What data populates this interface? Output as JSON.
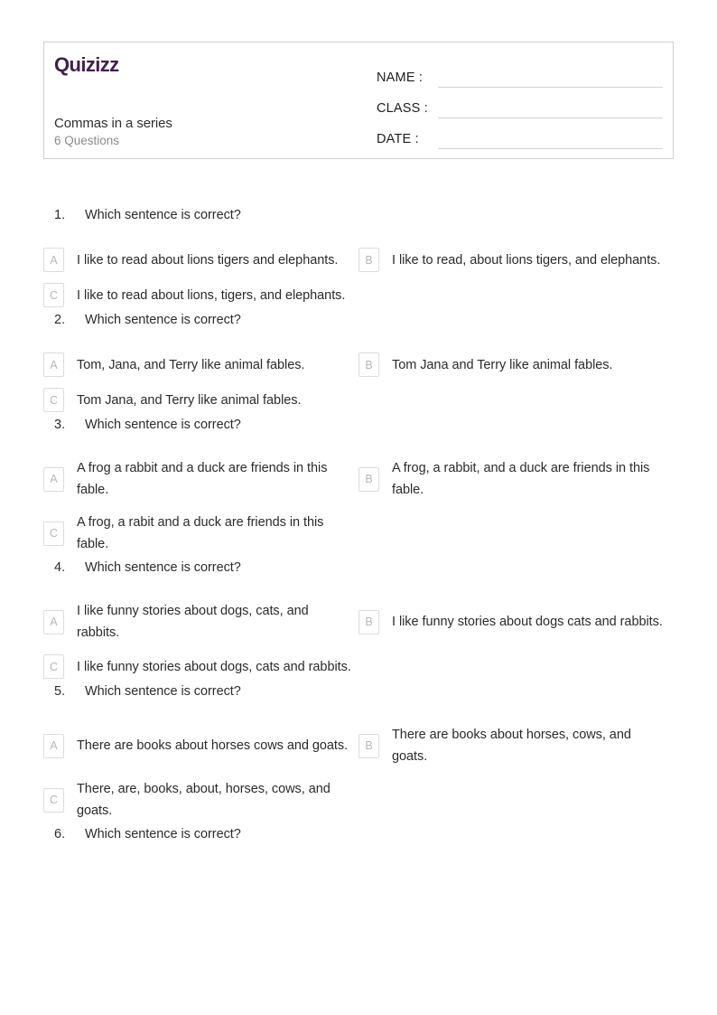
{
  "header": {
    "brand": "Quizizz",
    "worksheet_title": "Commas in a series",
    "question_count_label": "6 Questions",
    "fields": [
      {
        "label": "NAME :",
        "value": "",
        "name": "name-field"
      },
      {
        "label": "CLASS :",
        "value": "",
        "name": "class-field"
      },
      {
        "label": "DATE  :",
        "value": "",
        "name": "date-field"
      }
    ]
  },
  "colors": {
    "brand_purple": "#41204d",
    "text": "#2b2b2b",
    "muted": "#8b8b8b",
    "border": "#cfcfcf",
    "option_box_border": "#dcdcdc",
    "option_letter": "#b7b7b7",
    "field_line": "#d2d2d2"
  },
  "questions": [
    {
      "number": "1.",
      "prompt": "Which sentence is correct?",
      "options": [
        {
          "letter": "A",
          "text": "I like to read about lions tigers and elephants."
        },
        {
          "letter": "B",
          "text": "I like to read, about lions tigers, and elephants."
        },
        {
          "letter": "C",
          "text": "I like to read about lions, tigers, and elephants."
        }
      ]
    },
    {
      "number": "2.",
      "prompt": "Which sentence is correct?",
      "options": [
        {
          "letter": "A",
          "text": "Tom, Jana, and Terry like animal fables."
        },
        {
          "letter": "B",
          "text": "Tom Jana and Terry like animal fables."
        },
        {
          "letter": "C",
          "text": "Tom Jana, and Terry like animal fables."
        }
      ]
    },
    {
      "number": "3.",
      "prompt": "Which sentence is correct?",
      "options": [
        {
          "letter": "A",
          "text": "A frog a rabbit and a duck are friends in this fable."
        },
        {
          "letter": "B",
          "text": "A frog, a rabbit, and a duck are friends in this fable."
        },
        {
          "letter": "C",
          "text": "A frog, a rabit and a duck are friends in this fable."
        }
      ]
    },
    {
      "number": "4.",
      "prompt": "Which sentence is correct?",
      "options": [
        {
          "letter": "A",
          "text": "I like funny stories about dogs, cats, and rabbits."
        },
        {
          "letter": "B",
          "text": "I like funny stories about dogs cats and rabbits."
        },
        {
          "letter": "C",
          "text": "I like funny stories about dogs, cats and rabbits."
        }
      ]
    },
    {
      "number": "5.",
      "prompt": "Which sentence is correct?",
      "options": [
        {
          "letter": "A",
          "text": "There are books about horses cows and goats."
        },
        {
          "letter": "B",
          "text": "There are books about horses, cows, and goats."
        },
        {
          "letter": "C",
          "text": "There, are, books, about, horses, cows, and goats."
        }
      ]
    },
    {
      "number": "6.",
      "prompt": "Which sentence is correct?",
      "options": []
    }
  ]
}
